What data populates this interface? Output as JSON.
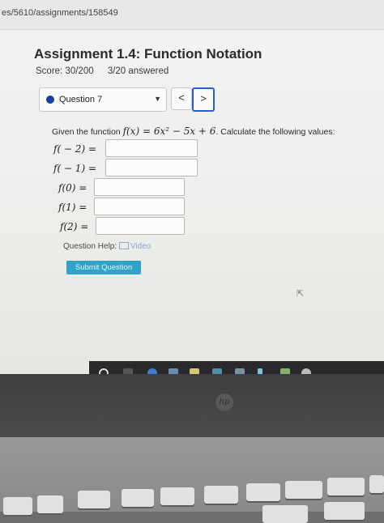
{
  "browser": {
    "url": "es/5610/assignments/158549"
  },
  "assignment": {
    "title": "Assignment 1.4: Function Notation",
    "score": "Score: 30/200",
    "answered": "3/20 answered"
  },
  "question_nav": {
    "selected": "Question 7",
    "prev_label": "<",
    "next_label": ">"
  },
  "question": {
    "intro": "Given the function",
    "function": "f(x) = 6x² − 5x + 6",
    "instruction": ". Calculate the following values:",
    "items": [
      {
        "label": "f( − 2) =",
        "value": ""
      },
      {
        "label": "f( − 1) =",
        "value": ""
      },
      {
        "label": "f(0) =",
        "value": ""
      },
      {
        "label": "f(1) =",
        "value": ""
      },
      {
        "label": "f(2) =",
        "value": ""
      }
    ]
  },
  "help": {
    "label": "Question Help:",
    "video": "Video"
  },
  "submit_label": "Submit Question",
  "laptop": {
    "brand": "hp"
  },
  "colors": {
    "accent": "#2fa3c9",
    "nav_highlight": "#2b5ec9",
    "dot": "#1b3fa0"
  }
}
